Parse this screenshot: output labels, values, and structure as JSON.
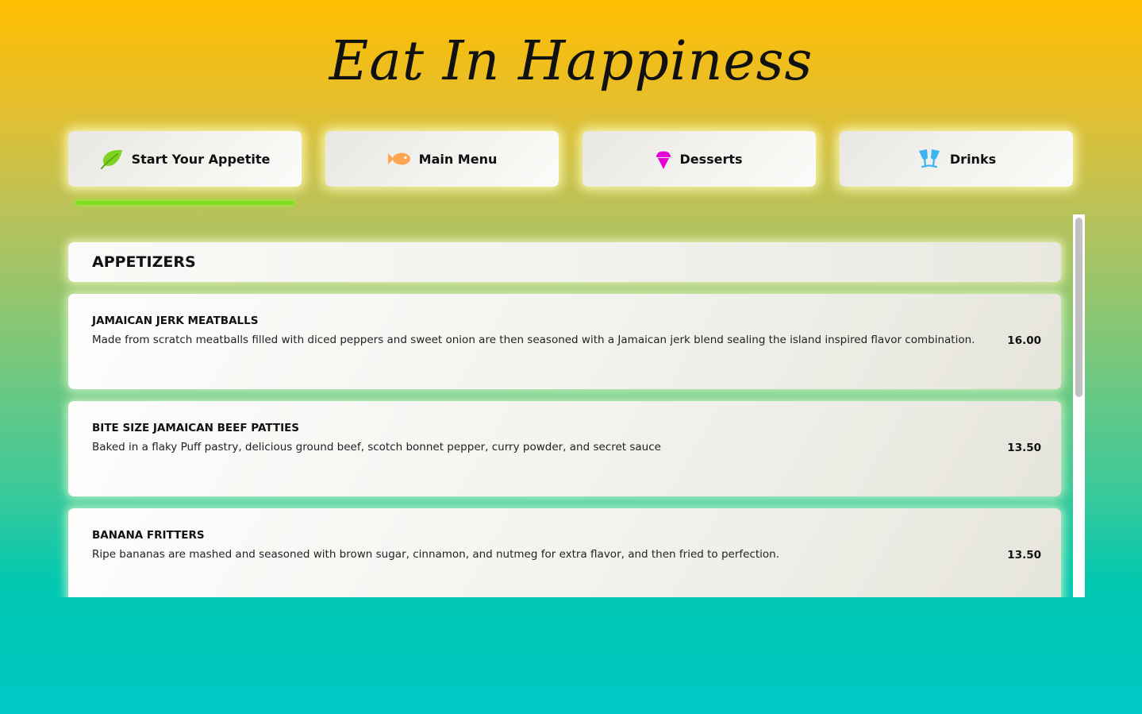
{
  "header": {
    "title": "Eat In Happiness"
  },
  "tabs": [
    {
      "label": "Start Your Appetite",
      "icon": "leaf-icon",
      "icon_color": "#7ed321",
      "active": true
    },
    {
      "label": "Main Menu",
      "icon": "fish-icon",
      "icon_color": "#ffa552",
      "active": false
    },
    {
      "label": "Desserts",
      "icon": "ice-cream-icon",
      "icon_color": "#e600d6",
      "active": false
    },
    {
      "label": "Drinks",
      "icon": "glasses-cheers-icon",
      "icon_color": "#3ab4f2",
      "active": false
    }
  ],
  "active_indicator_color": "#7ee021",
  "menu": {
    "section_title": "APPETIZERS",
    "items": [
      {
        "name": "JAMAICAN JERK MEATBALLS",
        "description": "Made from scratch meatballs filled with diced peppers and sweet onion are then seasoned with a Jamaican jerk blend sealing the island inspired flavor combination.",
        "price": "16.00"
      },
      {
        "name": "BITE SIZE JAMAICAN BEEF PATTIES",
        "description": "Baked in a flaky Puff pastry, delicious ground beef, scotch bonnet pepper, curry powder, and secret sauce",
        "price": "13.50"
      },
      {
        "name": "BANANA FRITTERS",
        "description": "Ripe bananas are mashed and seasoned with brown sugar, cinnamon, and nutmeg for extra flavor, and then fried to perfection.",
        "price": "13.50"
      }
    ]
  }
}
